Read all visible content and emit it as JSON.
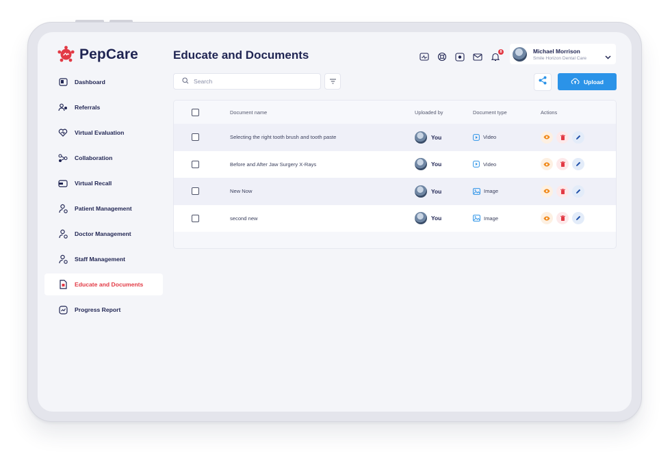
{
  "app": {
    "name": "PepCare"
  },
  "colors": {
    "brand_red": "#e23a45",
    "navy": "#1f2452",
    "primary_blue": "#2b93e8"
  },
  "sidebar": {
    "items": [
      {
        "label": "Dashboard",
        "icon": "dashboard-icon",
        "active": false
      },
      {
        "label": "Referrals",
        "icon": "referrals-icon",
        "active": false
      },
      {
        "label": "Virtual Evaluation",
        "icon": "virtual-evaluation-icon",
        "active": false
      },
      {
        "label": "Collaboration",
        "icon": "collaboration-icon",
        "active": false
      },
      {
        "label": "Virtual Recall",
        "icon": "virtual-recall-icon",
        "active": false
      },
      {
        "label": "Patient Management",
        "icon": "patient-management-icon",
        "active": false
      },
      {
        "label": "Doctor Management",
        "icon": "doctor-management-icon",
        "active": false
      },
      {
        "label": "Staff Management",
        "icon": "staff-management-icon",
        "active": false
      },
      {
        "label": "Educate and Documents",
        "icon": "document-icon",
        "active": true
      },
      {
        "label": "Progress Report",
        "icon": "progress-report-icon",
        "active": false
      }
    ]
  },
  "header": {
    "title": "Educate and Documents",
    "icons": [
      "monitor-icon",
      "support-icon",
      "record-icon",
      "mail-icon",
      "bell-icon"
    ],
    "notification_count": "8",
    "user": {
      "name": "Michael Morrison",
      "org": "Smile Horizon Dental Care"
    }
  },
  "toolbar": {
    "search_placeholder": "Search",
    "upload_label": "Upload"
  },
  "table": {
    "columns": [
      "Document name",
      "Uploaded by",
      "Document type",
      "Actions"
    ],
    "rows": [
      {
        "name": "Selecting the right tooth brush and tooth paste",
        "uploaded_by": "You",
        "type": "Video"
      },
      {
        "name": "Before and After Jaw Surgery X-Rays",
        "uploaded_by": "You",
        "type": "Video"
      },
      {
        "name": "New Now",
        "uploaded_by": "You",
        "type": "Image"
      },
      {
        "name": "second new",
        "uploaded_by": "You",
        "type": "Image"
      }
    ]
  }
}
